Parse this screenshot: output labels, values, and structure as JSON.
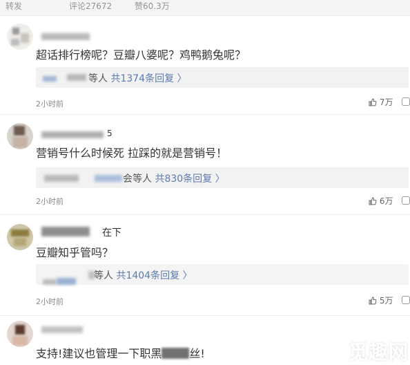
{
  "header": {
    "forward": "转发",
    "comments": "评论27672",
    "likes": "赞60.3万"
  },
  "comments": [
    {
      "text": "超话排行榜呢？豆瓣八婆呢？鸡鸭鹅兔呢？",
      "reply_suffix": "等人",
      "reply_count": "共1374条回复",
      "time": "2小时前",
      "likes": "7万"
    },
    {
      "text": "营销号什么时候死 拉踩的就是营销号！",
      "name_tail": "5",
      "reply_suffix": "会等人",
      "reply_count": "共830条回复",
      "time": "2小时前",
      "likes": "6万"
    },
    {
      "text": "豆瓣知乎管吗？",
      "name_tail": "在下",
      "reply_suffix": "等人",
      "reply_count": "共1404条回复",
      "time": "2小时前",
      "likes": "5万"
    },
    {
      "text_start": "支持!建议也管理一下职黑",
      "text_end": "丝!"
    }
  ],
  "watermark": "觅趣网",
  "colors": {
    "link": "#5b7ab1",
    "reply_bg": "#f2f2f2",
    "text": "#333333",
    "meta": "#888888"
  },
  "icons": {
    "like": "thumb-up-icon",
    "reply": "comment-bubble-icon"
  }
}
